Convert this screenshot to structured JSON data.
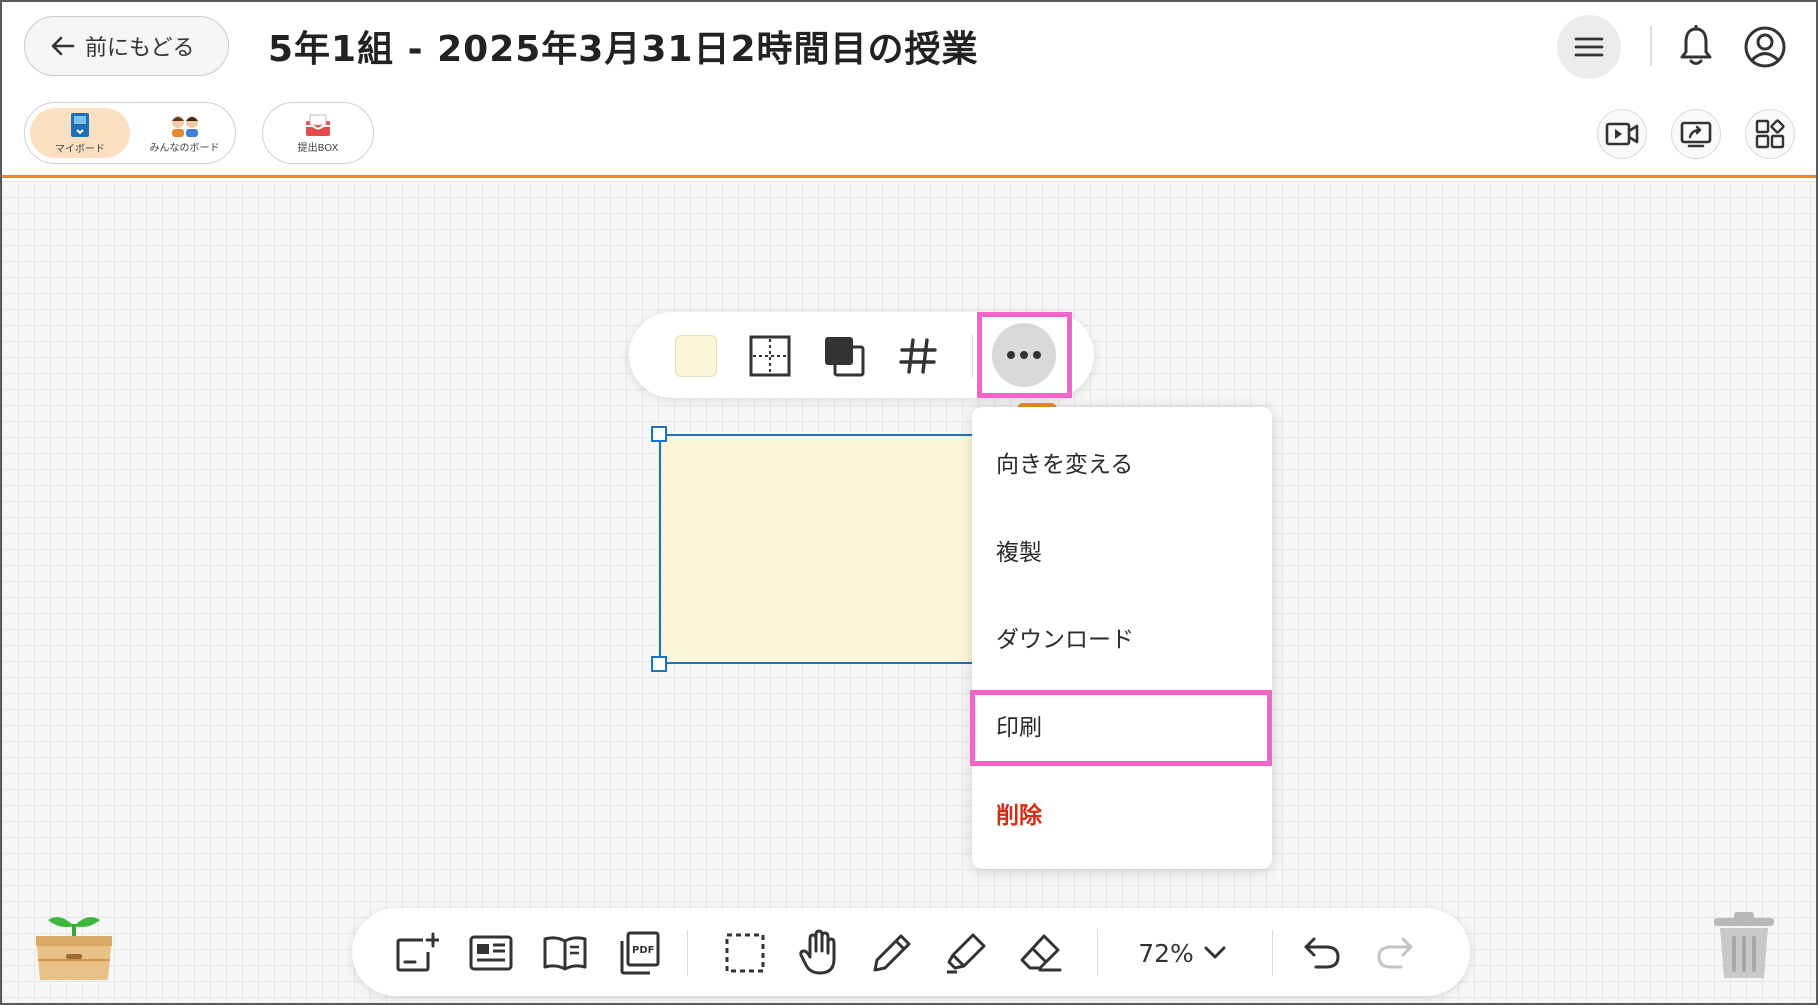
{
  "header": {
    "back_label": "前にもどる",
    "title": "5年1組 - 2025年3月31日2時間目の授業"
  },
  "board_switch": {
    "my_board_label": "マイボード",
    "all_board_label": "みんなのボード"
  },
  "submit_box": {
    "label": "提出BOX"
  },
  "card": {
    "color": "#fbf6d9"
  },
  "context_menu": {
    "items": [
      {
        "label": "向きを変える"
      },
      {
        "label": "複製"
      },
      {
        "label": "ダウンロード"
      },
      {
        "label": "印刷",
        "highlighted": true
      },
      {
        "label": "削除",
        "danger": true
      }
    ]
  },
  "bottom_toolbar": {
    "zoom": "72%"
  },
  "colors": {
    "accent": "#e8892e",
    "highlight": "#f266c9",
    "selection": "#1a73c4",
    "danger": "#d72c10"
  }
}
